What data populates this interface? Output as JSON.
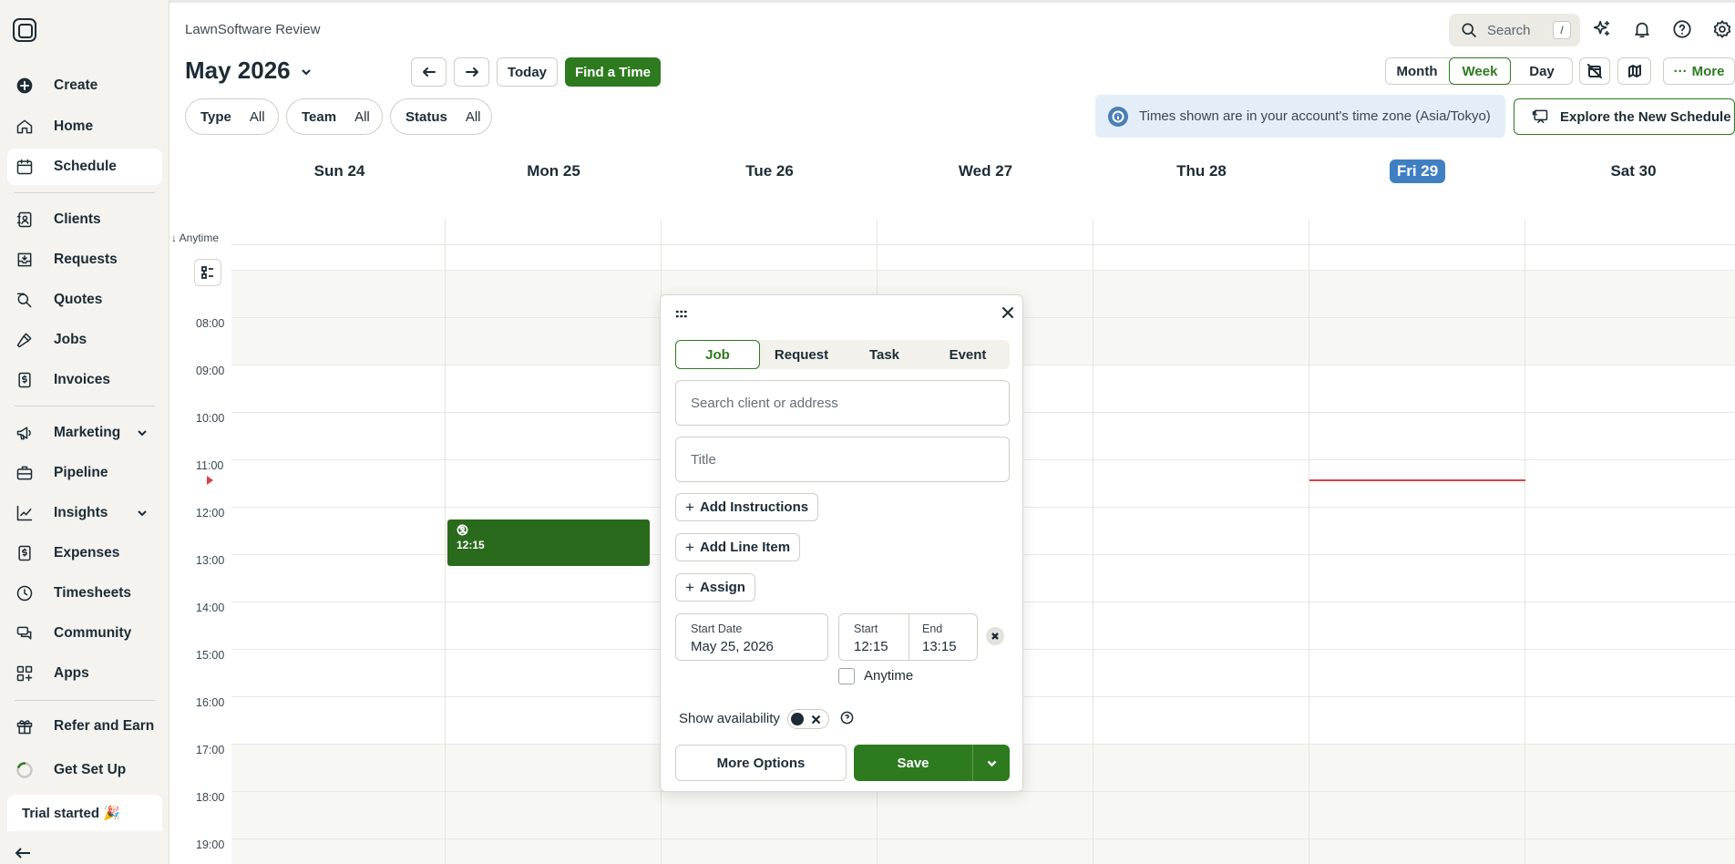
{
  "sidebar": {
    "items": [
      {
        "label": "Create",
        "icon": "plus-circle-icon"
      },
      {
        "label": "Home",
        "icon": "home-icon"
      },
      {
        "label": "Schedule",
        "icon": "calendar-icon",
        "active": true
      },
      {
        "label": "Clients",
        "icon": "address-book-icon"
      },
      {
        "label": "Requests",
        "icon": "inbox-icon"
      },
      {
        "label": "Quotes",
        "icon": "quote-search-icon"
      },
      {
        "label": "Jobs",
        "icon": "hammer-icon"
      },
      {
        "label": "Invoices",
        "icon": "invoice-icon"
      },
      {
        "label": "Marketing",
        "icon": "megaphone-icon",
        "expandable": true
      },
      {
        "label": "Pipeline",
        "icon": "briefcase-icon"
      },
      {
        "label": "Insights",
        "icon": "chart-icon",
        "expandable": true
      },
      {
        "label": "Expenses",
        "icon": "dollar-icon"
      },
      {
        "label": "Timesheets",
        "icon": "clock-icon"
      },
      {
        "label": "Community",
        "icon": "community-icon"
      },
      {
        "label": "Apps",
        "icon": "apps-icon"
      },
      {
        "label": "Refer and Earn",
        "icon": "gift-icon"
      },
      {
        "label": "Get Set Up",
        "icon": "progress-icon"
      }
    ],
    "trial_label": "Trial started 🎉"
  },
  "header": {
    "account_name": "LawnSoftware Review",
    "search_placeholder": "Search",
    "search_shortcut": "/"
  },
  "toolbar": {
    "month_title": "May 2026",
    "today_label": "Today",
    "find_time_label": "Find a Time",
    "views": [
      "Month",
      "Week",
      "Day"
    ],
    "active_view": "Week",
    "more_label": "More"
  },
  "filters": [
    {
      "label": "Type",
      "value": "All"
    },
    {
      "label": "Team",
      "value": "All"
    },
    {
      "label": "Status",
      "value": "All"
    }
  ],
  "timezone_banner": "Times shown are in your account's time zone (Asia/Tokyo)",
  "explore_label": "Explore the New Schedule",
  "calendar": {
    "days": [
      "Sun 24",
      "Mon 25",
      "Tue 26",
      "Wed 27",
      "Thu 28",
      "Fri 29",
      "Sat 30"
    ],
    "today": "Fri 29",
    "anytime_label": "↓ Anytime",
    "hours": [
      "08:00",
      "09:00",
      "10:00",
      "11:00",
      "12:00",
      "13:00",
      "14:00",
      "15:00",
      "16:00",
      "17:00",
      "18:00",
      "19:00"
    ],
    "event": {
      "time": "12:15"
    }
  },
  "popup": {
    "tabs": [
      "Job",
      "Request",
      "Task",
      "Event"
    ],
    "active_tab": "Job",
    "search_placeholder": "Search client or address",
    "title_placeholder": "Title",
    "add_instructions": "Add Instructions",
    "add_line_item": "Add Line Item",
    "assign": "Assign",
    "start_date_label": "Start Date",
    "start_date_value": "May 25, 2026",
    "start_label": "Start",
    "start_value": "12:15",
    "end_label": "End",
    "end_value": "13:15",
    "anytime_label": "Anytime",
    "show_availability": "Show availability",
    "more_options": "More Options",
    "save": "Save"
  }
}
